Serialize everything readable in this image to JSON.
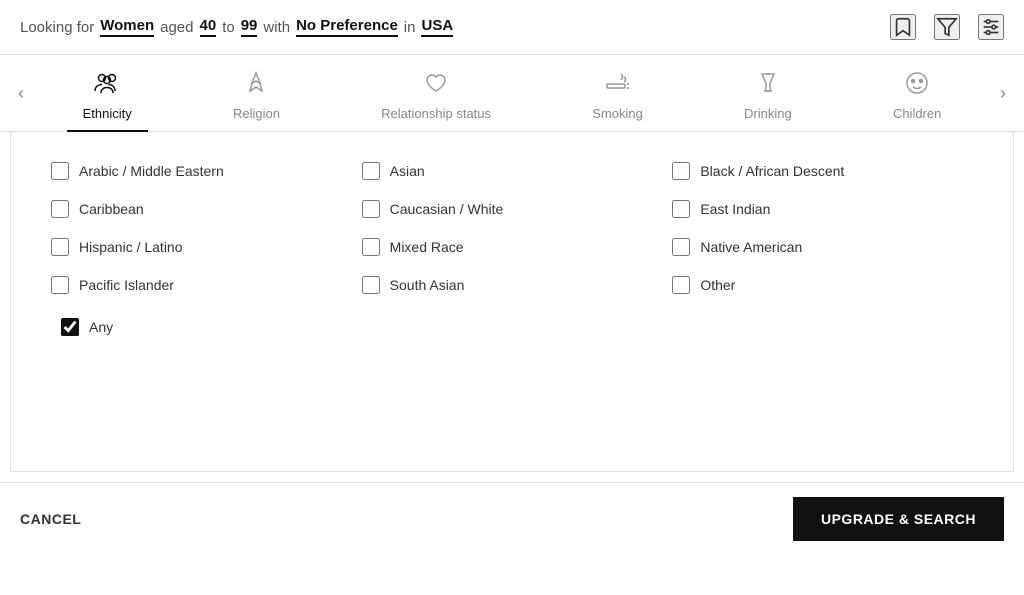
{
  "header": {
    "looking_for_label": "Looking for",
    "gender": "Women",
    "aged_label": "aged",
    "age_min": "40",
    "to_label": "to",
    "age_max": "99",
    "with_label": "with",
    "preference": "No Preference",
    "in_label": "in",
    "location": "USA"
  },
  "tabs": [
    {
      "id": "ethnicity",
      "label": "Ethnicity",
      "active": true
    },
    {
      "id": "religion",
      "label": "Religion",
      "active": false
    },
    {
      "id": "relationship",
      "label": "Relationship status",
      "active": false
    },
    {
      "id": "smoking",
      "label": "Smoking",
      "active": false
    },
    {
      "id": "drinking",
      "label": "Drinking",
      "active": false
    },
    {
      "id": "children",
      "label": "Children",
      "active": false
    }
  ],
  "options": [
    {
      "id": "arabic",
      "label": "Arabic / Middle Eastern",
      "checked": false
    },
    {
      "id": "asian",
      "label": "Asian",
      "checked": false
    },
    {
      "id": "black",
      "label": "Black / African Descent",
      "checked": false
    },
    {
      "id": "caribbean",
      "label": "Caribbean",
      "checked": false
    },
    {
      "id": "caucasian",
      "label": "Caucasian / White",
      "checked": false
    },
    {
      "id": "east_indian",
      "label": "East Indian",
      "checked": false
    },
    {
      "id": "hispanic",
      "label": "Hispanic / Latino",
      "checked": false
    },
    {
      "id": "mixed",
      "label": "Mixed Race",
      "checked": false
    },
    {
      "id": "native",
      "label": "Native American",
      "checked": false
    },
    {
      "id": "pacific",
      "label": "Pacific Islander",
      "checked": false
    },
    {
      "id": "south_asian",
      "label": "South Asian",
      "checked": false
    },
    {
      "id": "other",
      "label": "Other",
      "checked": false
    }
  ],
  "any": {
    "label": "Any",
    "checked": true
  },
  "footer": {
    "cancel_label": "CANCEL",
    "upgrade_label": "UPGRADE & SEARCH"
  }
}
